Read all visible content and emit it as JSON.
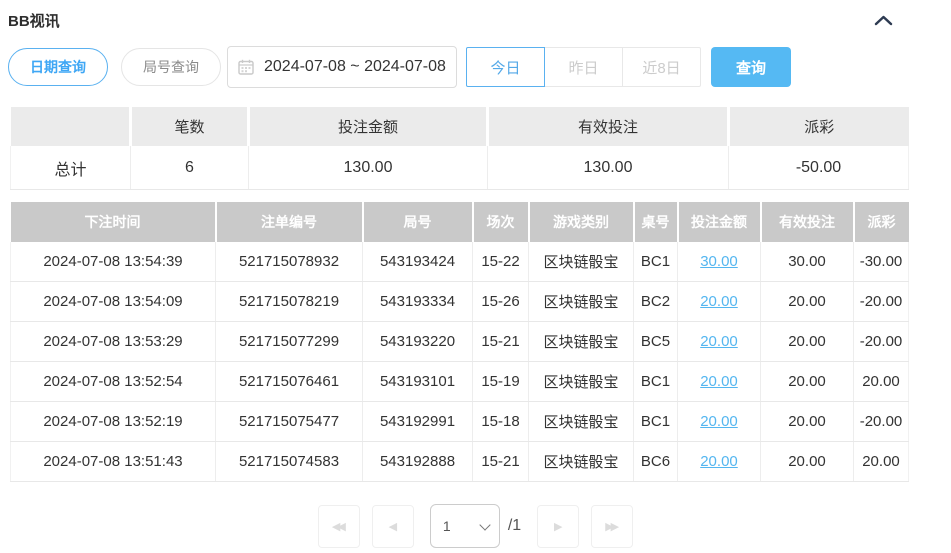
{
  "header": {
    "title": "BB视讯",
    "collapse_icon": "chevron-up"
  },
  "filters": {
    "date_query_label": "日期查询",
    "round_query_label": "局号查询",
    "date_range": "2024-07-08 ~ 2024-07-08",
    "calendar_icon": "calendar",
    "quick_ranges": [
      {
        "label": "今日",
        "active": true
      },
      {
        "label": "昨日",
        "active": false
      },
      {
        "label": "近8日",
        "active": false
      }
    ],
    "search_label": "查询"
  },
  "summary": {
    "columns": [
      "",
      "笔数",
      "投注金额",
      "有效投注",
      "派彩"
    ],
    "total": {
      "label": "总计",
      "count": "6",
      "bet_amount": "130.00",
      "valid_bet": "130.00",
      "payout": "-50.00"
    }
  },
  "table": {
    "columns": [
      "下注时间",
      "注单编号",
      "局号",
      "场次",
      "游戏类别",
      "桌号",
      "投注金额",
      "有效投注",
      "派彩"
    ],
    "rows": [
      [
        "2024-07-08 13:54:39",
        "521715078932",
        "543193424",
        "15-22",
        "区块链骰宝",
        "BC1",
        "30.00",
        "30.00",
        "-30.00"
      ],
      [
        "2024-07-08 13:54:09",
        "521715078219",
        "543193334",
        "15-26",
        "区块链骰宝",
        "BC2",
        "20.00",
        "20.00",
        "-20.00"
      ],
      [
        "2024-07-08 13:53:29",
        "521715077299",
        "543193220",
        "15-21",
        "区块链骰宝",
        "BC5",
        "20.00",
        "20.00",
        "-20.00"
      ],
      [
        "2024-07-08 13:52:54",
        "521715076461",
        "543193101",
        "15-19",
        "区块链骰宝",
        "BC1",
        "20.00",
        "20.00",
        "20.00"
      ],
      [
        "2024-07-08 13:52:19",
        "521715075477",
        "543192991",
        "15-18",
        "区块链骰宝",
        "BC1",
        "20.00",
        "20.00",
        "-20.00"
      ],
      [
        "2024-07-08 13:51:43",
        "521715074583",
        "543192888",
        "15-21",
        "区块链骰宝",
        "BC6",
        "20.00",
        "20.00",
        "20.00"
      ]
    ]
  },
  "pagination": {
    "page": "1",
    "total_label": "/1",
    "icons": {
      "first": "◀◀",
      "prev": "◀",
      "next": "▶",
      "last": "▶▶"
    }
  },
  "colors": {
    "accent_blue": "#55b9f3",
    "link_blue": "#54b6f0",
    "negative_red": "#f4607c",
    "grid_header_gray": "#c9c9c9",
    "summary_header_gray": "#ebebeb"
  }
}
